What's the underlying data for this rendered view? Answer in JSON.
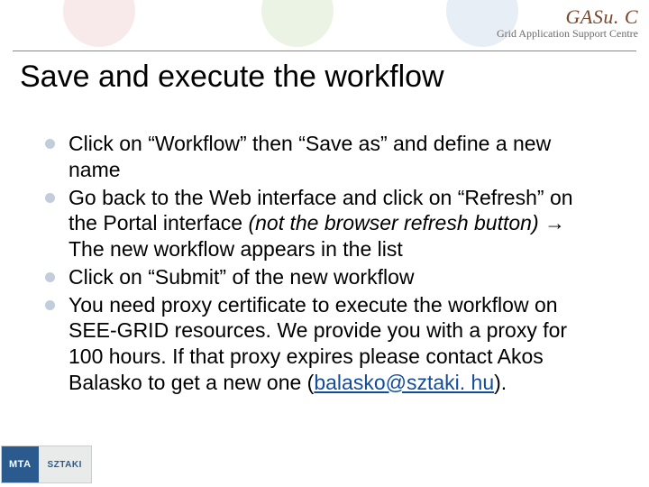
{
  "logo": {
    "main": "GASu. C",
    "sub": "Grid Application Support Centre"
  },
  "title": "Save and execute the workflow",
  "bullets": [
    {
      "html": "Click on “Workflow” then “Save as” and define a new name"
    },
    {
      "html": "Go back to the Web interface and click on “Refresh” on the Portal interface <span class=\"italic\">(not the browser refresh button)</span> <span class=\"arrow\">→</span> The new workflow appears in the list"
    },
    {
      "html": "Click on “Submit” of the new workflow"
    },
    {
      "html": "You need proxy certificate to execute the workflow on SEE-GRID resources. We provide you with a proxy for 100 hours. If that proxy expires please contact Akos Balasko to get a new one (<a class=\"mail\" href=\"#\" data-name=\"email-link\" data-interactable=\"true\">balasko@sztaki. hu</a>)."
    }
  ],
  "footer": {
    "left": "MTA",
    "right": "SZTAKI"
  }
}
